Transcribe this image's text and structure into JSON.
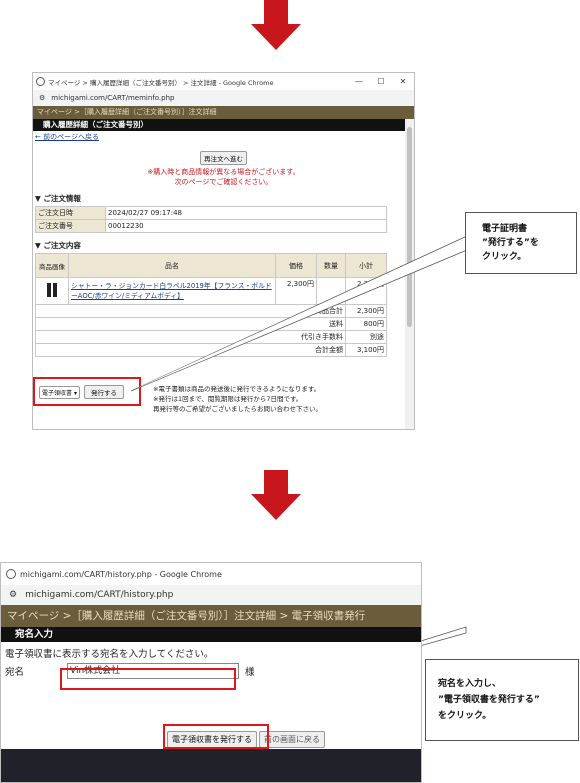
{
  "colors": {
    "accent_red": "#c8161d",
    "site_bar": "#6a5d3c",
    "site_bar_text": "#e7dcc0",
    "highlight": "#e0161b"
  },
  "window1": {
    "title": "マイページ > 購入履歴詳細（ご注文番号別） > 注文詳細 - Google Chrome",
    "url": "michigami.com/CART/meminfo.php",
    "breadcrumb": "マイページ >［購入履歴詳細（ご注文番号別）］注文詳細",
    "section_title": "購入履歴詳細（ご注文番号別）",
    "back_link": "← 前のページへ戻る",
    "reorder_button": "再注文へ進む",
    "notice_line1": "※購入時と商品情報が異なる場合がございます。",
    "notice_line2": "次のページでご確認ください。",
    "order_info_heading": "▼ ご注文情報",
    "order_date_label": "ご注文日時",
    "order_date_value": "2024/02/27 09:17:48",
    "order_no_label": "ご注文番号",
    "order_no_value": "00012230",
    "order_content_heading": "▼ ご注文内容",
    "col_image": "商品画像",
    "col_name": "品名",
    "col_price": "価格",
    "col_qty": "数量",
    "col_subtotal": "小計",
    "product_name": "シャトー・ラ・ジョンカード白ラベル2019年【フランス・ボルドーAOC/赤ワイン/ミディアムボディ】",
    "product_price": "2,300円",
    "product_subtotal": "2,300円",
    "goods_total_label": "商品合計",
    "goods_total_value": "2,300円",
    "shipping_label": "送料",
    "shipping_value": "800円",
    "cod_label": "代引き手数料",
    "cod_value": "別途",
    "grand_total_label": "合計金額",
    "grand_total_value": "3,100円",
    "doc_select_value": "電子領収書",
    "issue_button": "発行する",
    "issue_note1": "※電子書類は商品の発送後に発行できるようになります。",
    "issue_note2": "※発行は1回まで、閲覧期限は発行から7日間です。",
    "issue_note3": "再発行等のご希望がございましたらお問い合わせ下さい。"
  },
  "callout1": {
    "line1": "電子証明書",
    "line2": "”発行する”を",
    "line3": "クリック。"
  },
  "window2": {
    "title": "michigami.com/CART/history.php - Google Chrome",
    "url": "michigami.com/CART/history.php",
    "breadcrumb": "マイページ >［購入履歴詳細（ご注文番号別）］注文詳細 > 電子領収書発行",
    "section_title": "宛名入力",
    "instruction": "電子領収書に表示する宛名を入力してください。",
    "name_label": "宛名",
    "name_value": "Vin株式会社",
    "honorific": "様",
    "issue_button": "電子領収書を発行する",
    "back_button": "前の画面に戻る"
  },
  "callout2": {
    "line1": "宛名を入力し、",
    "line2": "”電子領収書を発行する”",
    "line3": "をクリック。"
  }
}
